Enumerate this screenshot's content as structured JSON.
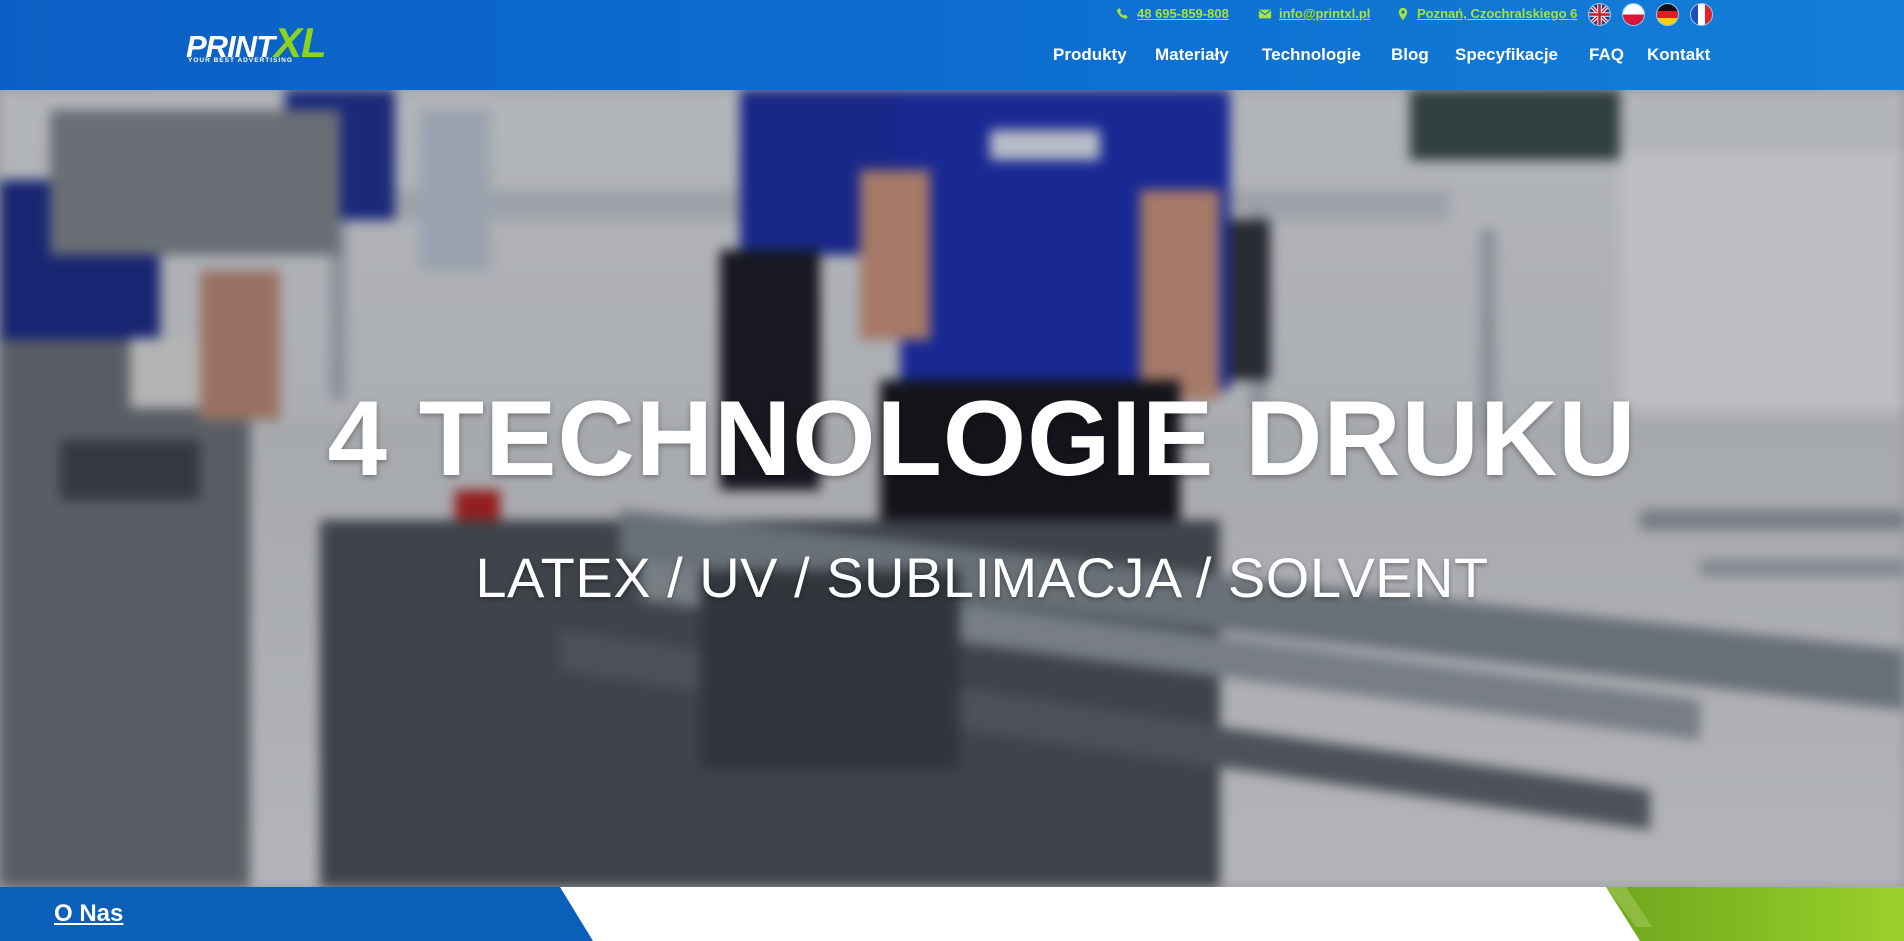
{
  "header": {
    "logo": {
      "main": "PRINT",
      "accent": "XL",
      "tagline": "YOUR BEST ADVERTISING"
    },
    "contact": {
      "phone": "48 695-859-808",
      "email": "info@printxl.pl",
      "address": "Poznań, Czochralskiego 6"
    },
    "languages": [
      "en",
      "pl",
      "de",
      "fr"
    ],
    "nav": [
      "Produkty",
      "Materiały",
      "Technologie",
      "Blog",
      "Specyfikacje",
      "FAQ",
      "Kontakt"
    ]
  },
  "hero": {
    "title": "4 TECHNOLOGIE DRUKU",
    "subtitle": "LATEX / UV / SUBLIMACJA / SOLVENT"
  },
  "section_tab": {
    "label": "O Nas"
  },
  "colors": {
    "header_blue": "#0d6fd0",
    "accent_green": "#8bd31c",
    "contact_green": "#a6e33d",
    "section_blue": "#0a5fb9"
  },
  "icons": [
    "phone-icon",
    "mail-icon",
    "location-icon"
  ]
}
